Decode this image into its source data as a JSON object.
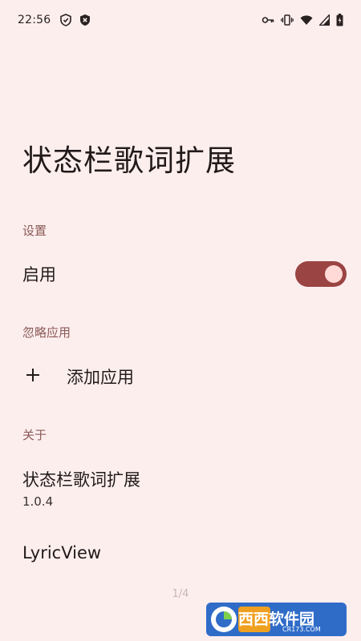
{
  "status_bar": {
    "time": "22:56",
    "left_icons": [
      "shield-check-icon",
      "security-x-icon"
    ],
    "right_icons": [
      "vpn-key-icon",
      "vibrate-icon",
      "wifi-icon",
      "signal-icon",
      "battery-icon"
    ]
  },
  "page": {
    "title": "状态栏歌词扩展"
  },
  "settings": {
    "header": "设置",
    "enable_label": "启用",
    "enable_on": true
  },
  "ignore_apps": {
    "header": "忽略应用",
    "add_label": "添加应用"
  },
  "about": {
    "header": "关于",
    "app_name": "状态栏歌词扩展",
    "version": "1.0.4",
    "lyricview_label": "LyricView"
  },
  "pager": {
    "text": "1/4"
  },
  "watermark": {
    "brand": "西西软件园",
    "url": "CR173.COM"
  },
  "colors": {
    "background": "#fdeeee",
    "accent": "#9a4443",
    "section_header": "#8a5a56",
    "toggle_thumb": "#ffdad7"
  }
}
